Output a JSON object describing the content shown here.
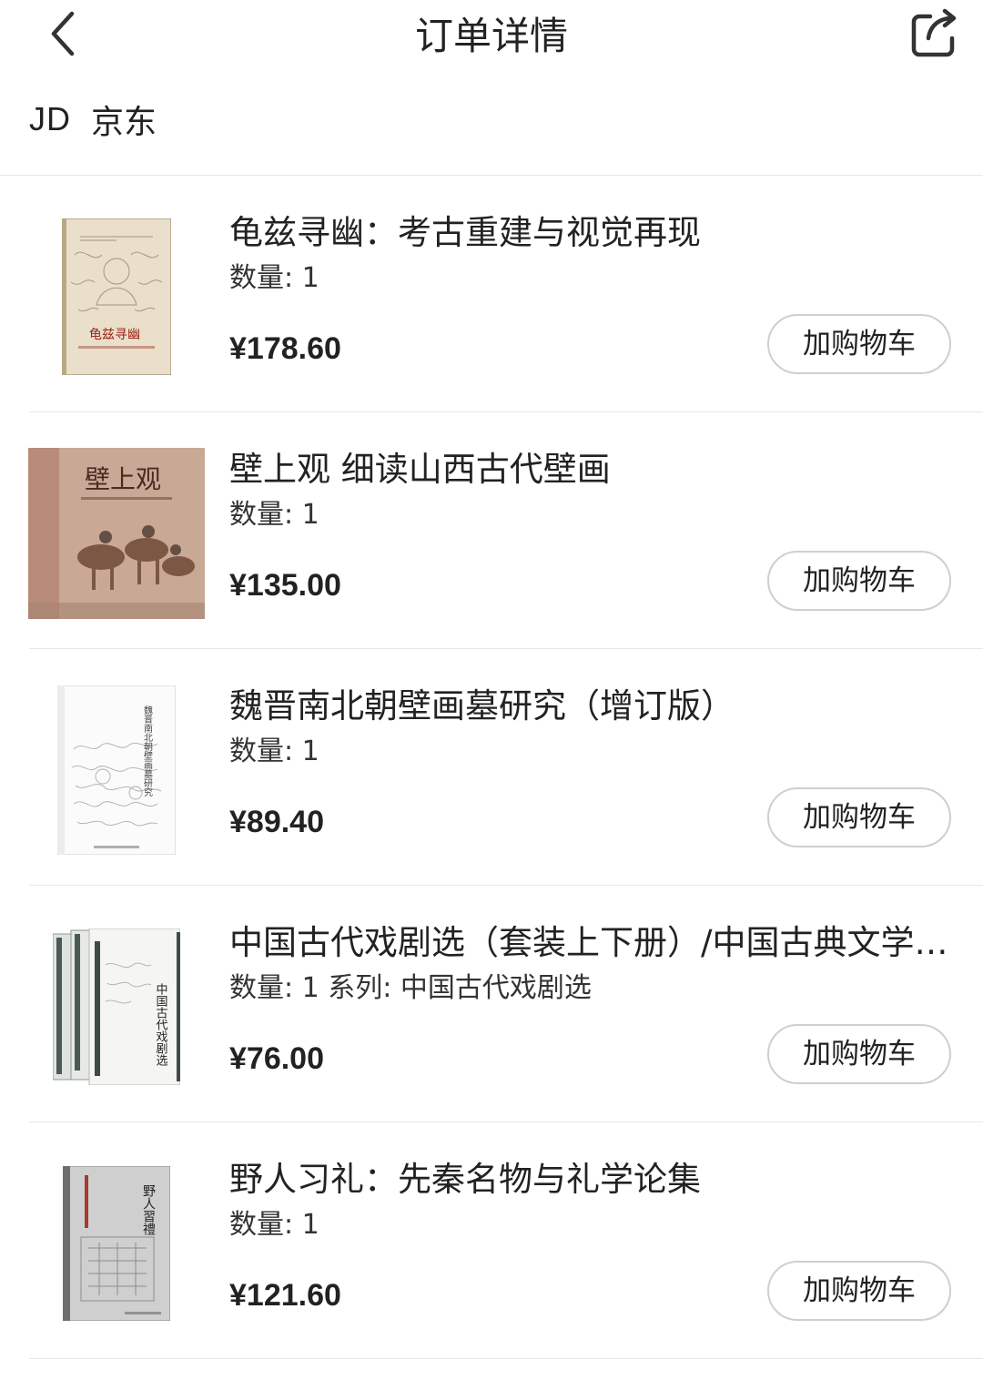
{
  "header": {
    "title": "订单详情"
  },
  "store": {
    "logo": "JD",
    "name": "京东"
  },
  "items": [
    {
      "title": "龟兹寻幽：考古重建与视觉再现",
      "quantity": "数量: 1",
      "price": "¥178.60",
      "button": "加购物车",
      "cover_text": "龟兹寻幽"
    },
    {
      "title": "壁上观 细读山西古代壁画",
      "quantity": "数量: 1",
      "price": "¥135.00",
      "button": "加购物车",
      "cover_text": "壁上观"
    },
    {
      "title": "魏晋南北朝壁画墓研究（增订版）",
      "quantity": "数量: 1",
      "price": "¥89.40",
      "button": "加购物车",
      "cover_text": "魏晋南北朝壁画墓研究"
    },
    {
      "title": "中国古代戏剧选（套装上下册）/中国古典文学读本丛书",
      "quantity": "数量: 1 系列: 中国古代戏剧选",
      "price": "¥76.00",
      "button": "加购物车",
      "cover_text": "中国古代戏剧选"
    },
    {
      "title": "野人习礼：先秦名物与礼学论集",
      "quantity": "数量: 1",
      "price": "¥121.60",
      "button": "加购物车",
      "cover_text": "野人習禮"
    }
  ],
  "icons": {
    "back": "chevron-left-icon",
    "share": "share-icon"
  }
}
